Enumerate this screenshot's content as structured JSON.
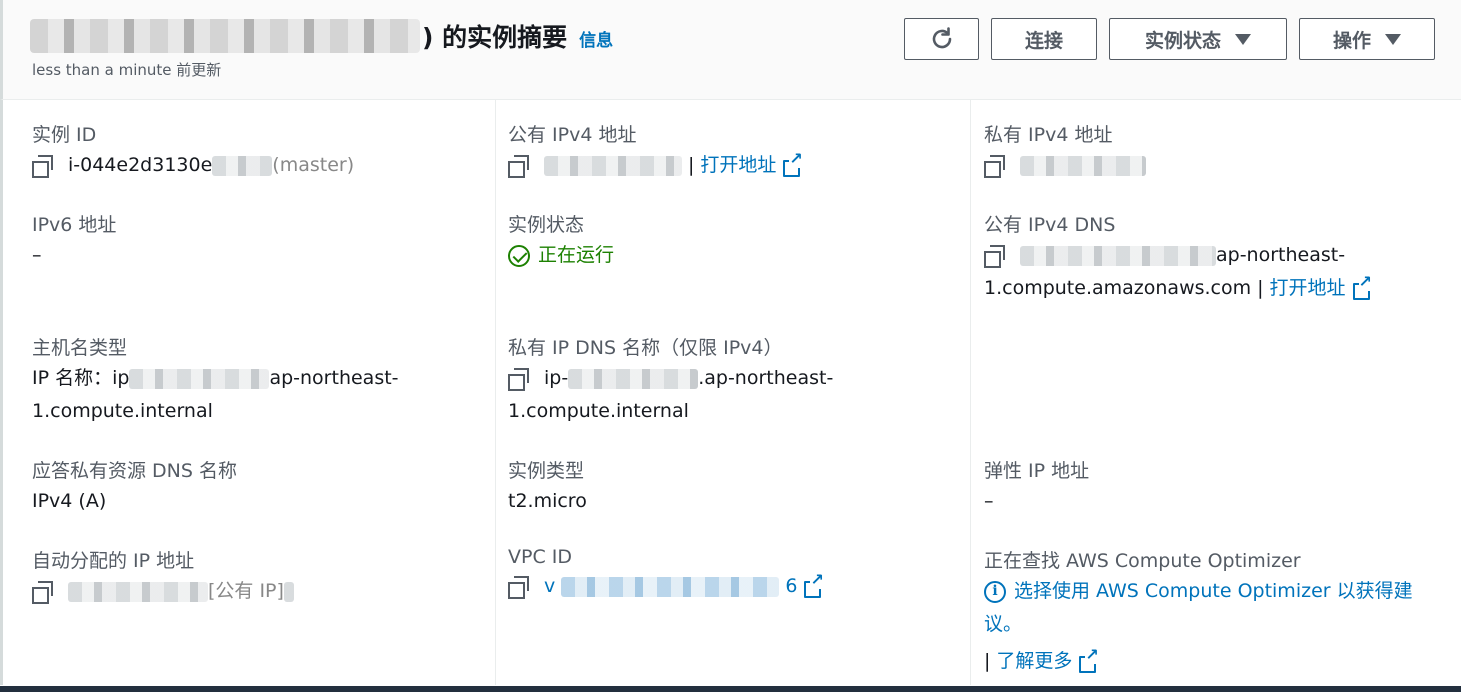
{
  "header": {
    "title": ") 的实例摘要",
    "info_link": "信息",
    "subtitle": "less than a minute 前更新",
    "buttons": {
      "refresh_icon": "refresh-icon",
      "connect": "连接",
      "instance_state": "实例状态",
      "actions": "操作"
    }
  },
  "fields": {
    "instance_id": {
      "label": "实例 ID",
      "value_prefix": "i-044e2d3130e",
      "value_suffix": "(master)"
    },
    "public_ipv4": {
      "label": "公有 IPv4 地址",
      "separator": "|",
      "link": "打开地址"
    },
    "private_ipv4": {
      "label": "私有 IPv4 地址"
    },
    "ipv6": {
      "label": "IPv6 地址",
      "value": "–"
    },
    "instance_status": {
      "label": "实例状态",
      "value": "正在运行",
      "status_color": "#1d8102"
    },
    "public_dns": {
      "label": "公有 IPv4 DNS",
      "value_suffix": "ap-northeast-",
      "value_line2": "1.compute.amazonaws.com",
      "separator": "|",
      "link": "打开地址"
    },
    "hostname_type": {
      "label": "主机名类型",
      "value_prefix": "IP 名称：ip",
      "value_suffix": "ap-northeast-",
      "value_line2": "1.compute.internal"
    },
    "private_dns": {
      "label": "私有 IP DNS 名称（仅限 IPv4）",
      "value_prefix": "ip-",
      "value_suffix": ".ap-northeast-",
      "value_line2": "1.compute.internal"
    },
    "resource_dns": {
      "label": "应答私有资源 DNS 名称",
      "value": "IPv4 (A)"
    },
    "instance_type": {
      "label": "实例类型",
      "value": "t2.micro"
    },
    "elastic_ip": {
      "label": "弹性 IP 地址",
      "value": "–"
    },
    "auto_ip": {
      "label": "自动分配的 IP 地址",
      "value_suffix": "[公有 IP]"
    },
    "vpc_id": {
      "label": "VPC ID",
      "value_prefix": "v",
      "value_suffix": "6"
    },
    "optimizer": {
      "label": "正在查找 AWS Compute Optimizer",
      "link_line1": "选择使用 AWS Compute Optimizer 以获得建",
      "link_line2": "议。",
      "separator": "|",
      "learn_more": "了解更多"
    }
  },
  "colors": {
    "link": "#0073bb",
    "text": "#16191f",
    "label": "#545b64",
    "success": "#1d8102"
  }
}
